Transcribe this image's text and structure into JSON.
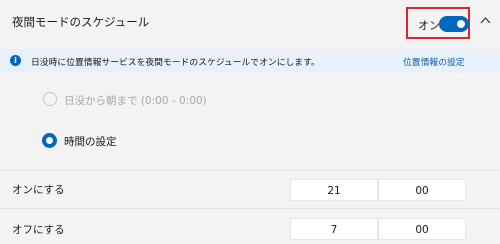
{
  "header": {
    "title": "夜間モードのスケジュール",
    "toggle_state_label": "オン",
    "toggle_on": true
  },
  "info": {
    "text": "日没時に位置情報サービスを夜間モードのスケジュールでオンにします。",
    "link": "位置情報の設定"
  },
  "schedule_options": [
    {
      "label": "日没から朝まで (0:00 - 0:00)",
      "selected": false,
      "enabled": false
    },
    {
      "label": "時間の設定",
      "selected": true,
      "enabled": true
    }
  ],
  "turn_on": {
    "label": "オンにする",
    "hour": "21",
    "minute": "00"
  },
  "turn_off": {
    "label": "オフにする",
    "hour": "7",
    "minute": "00"
  },
  "colors": {
    "accent": "#0067c0",
    "highlight_border": "#d8262f"
  }
}
